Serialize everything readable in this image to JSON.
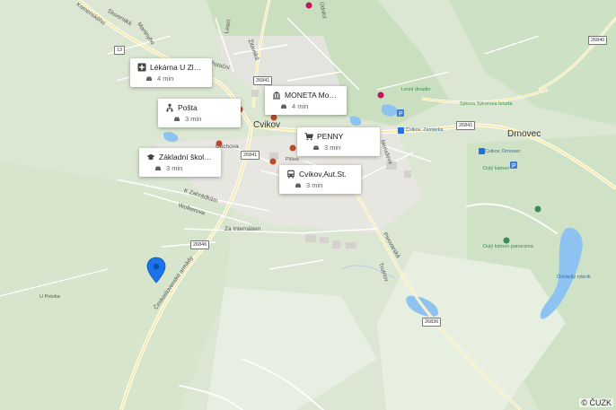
{
  "map": {
    "copyright": "© ČUZK",
    "pin": {
      "color": "#1a73e8"
    },
    "towns": [
      "Cvikov",
      "Drnovec"
    ],
    "road_shields": [
      "13",
      "26840",
      "26841",
      "26841",
      "26841",
      "26846",
      "26836"
    ],
    "street_labels": [
      "Komenského",
      "Slovenská",
      "Martinyho",
      "Potoční",
      "Žitavská",
      "Údolní",
      "Lesní",
      "Nerudova",
      "K Zahrádkám",
      "Wolkerova",
      "Za Internátem",
      "Československé armády",
      "Čechova",
      "Pivovarská",
      "Trutnov",
      "Pivovarská"
    ],
    "place_labels": [
      "Lesní divadlo",
      "Sýkora Sýkorova bouda",
      "Cvikov, Zastávka",
      "Cvikov, Drnovec",
      "Dutý kámen",
      "Dutý kámen panorama",
      "Ovčácký rybník",
      "U Potoka",
      "Plíšek"
    ]
  },
  "pois": [
    {
      "name": "Lékárna U Zlatéh...",
      "icon": "pharmacy-icon",
      "time": "4 min"
    },
    {
      "name": "MONETA Money ...",
      "icon": "bank-icon",
      "time": "4 min"
    },
    {
      "name": "Pošta",
      "icon": "post-office-icon",
      "time": "3 min"
    },
    {
      "name": "PENNY",
      "icon": "shopping-cart-icon",
      "time": "3 min"
    },
    {
      "name": "Základní škola Bo...",
      "icon": "school-icon",
      "time": "3 min"
    },
    {
      "name": "Cvikov,Aut.St.",
      "icon": "bus-stop-icon",
      "time": "3 min"
    }
  ]
}
